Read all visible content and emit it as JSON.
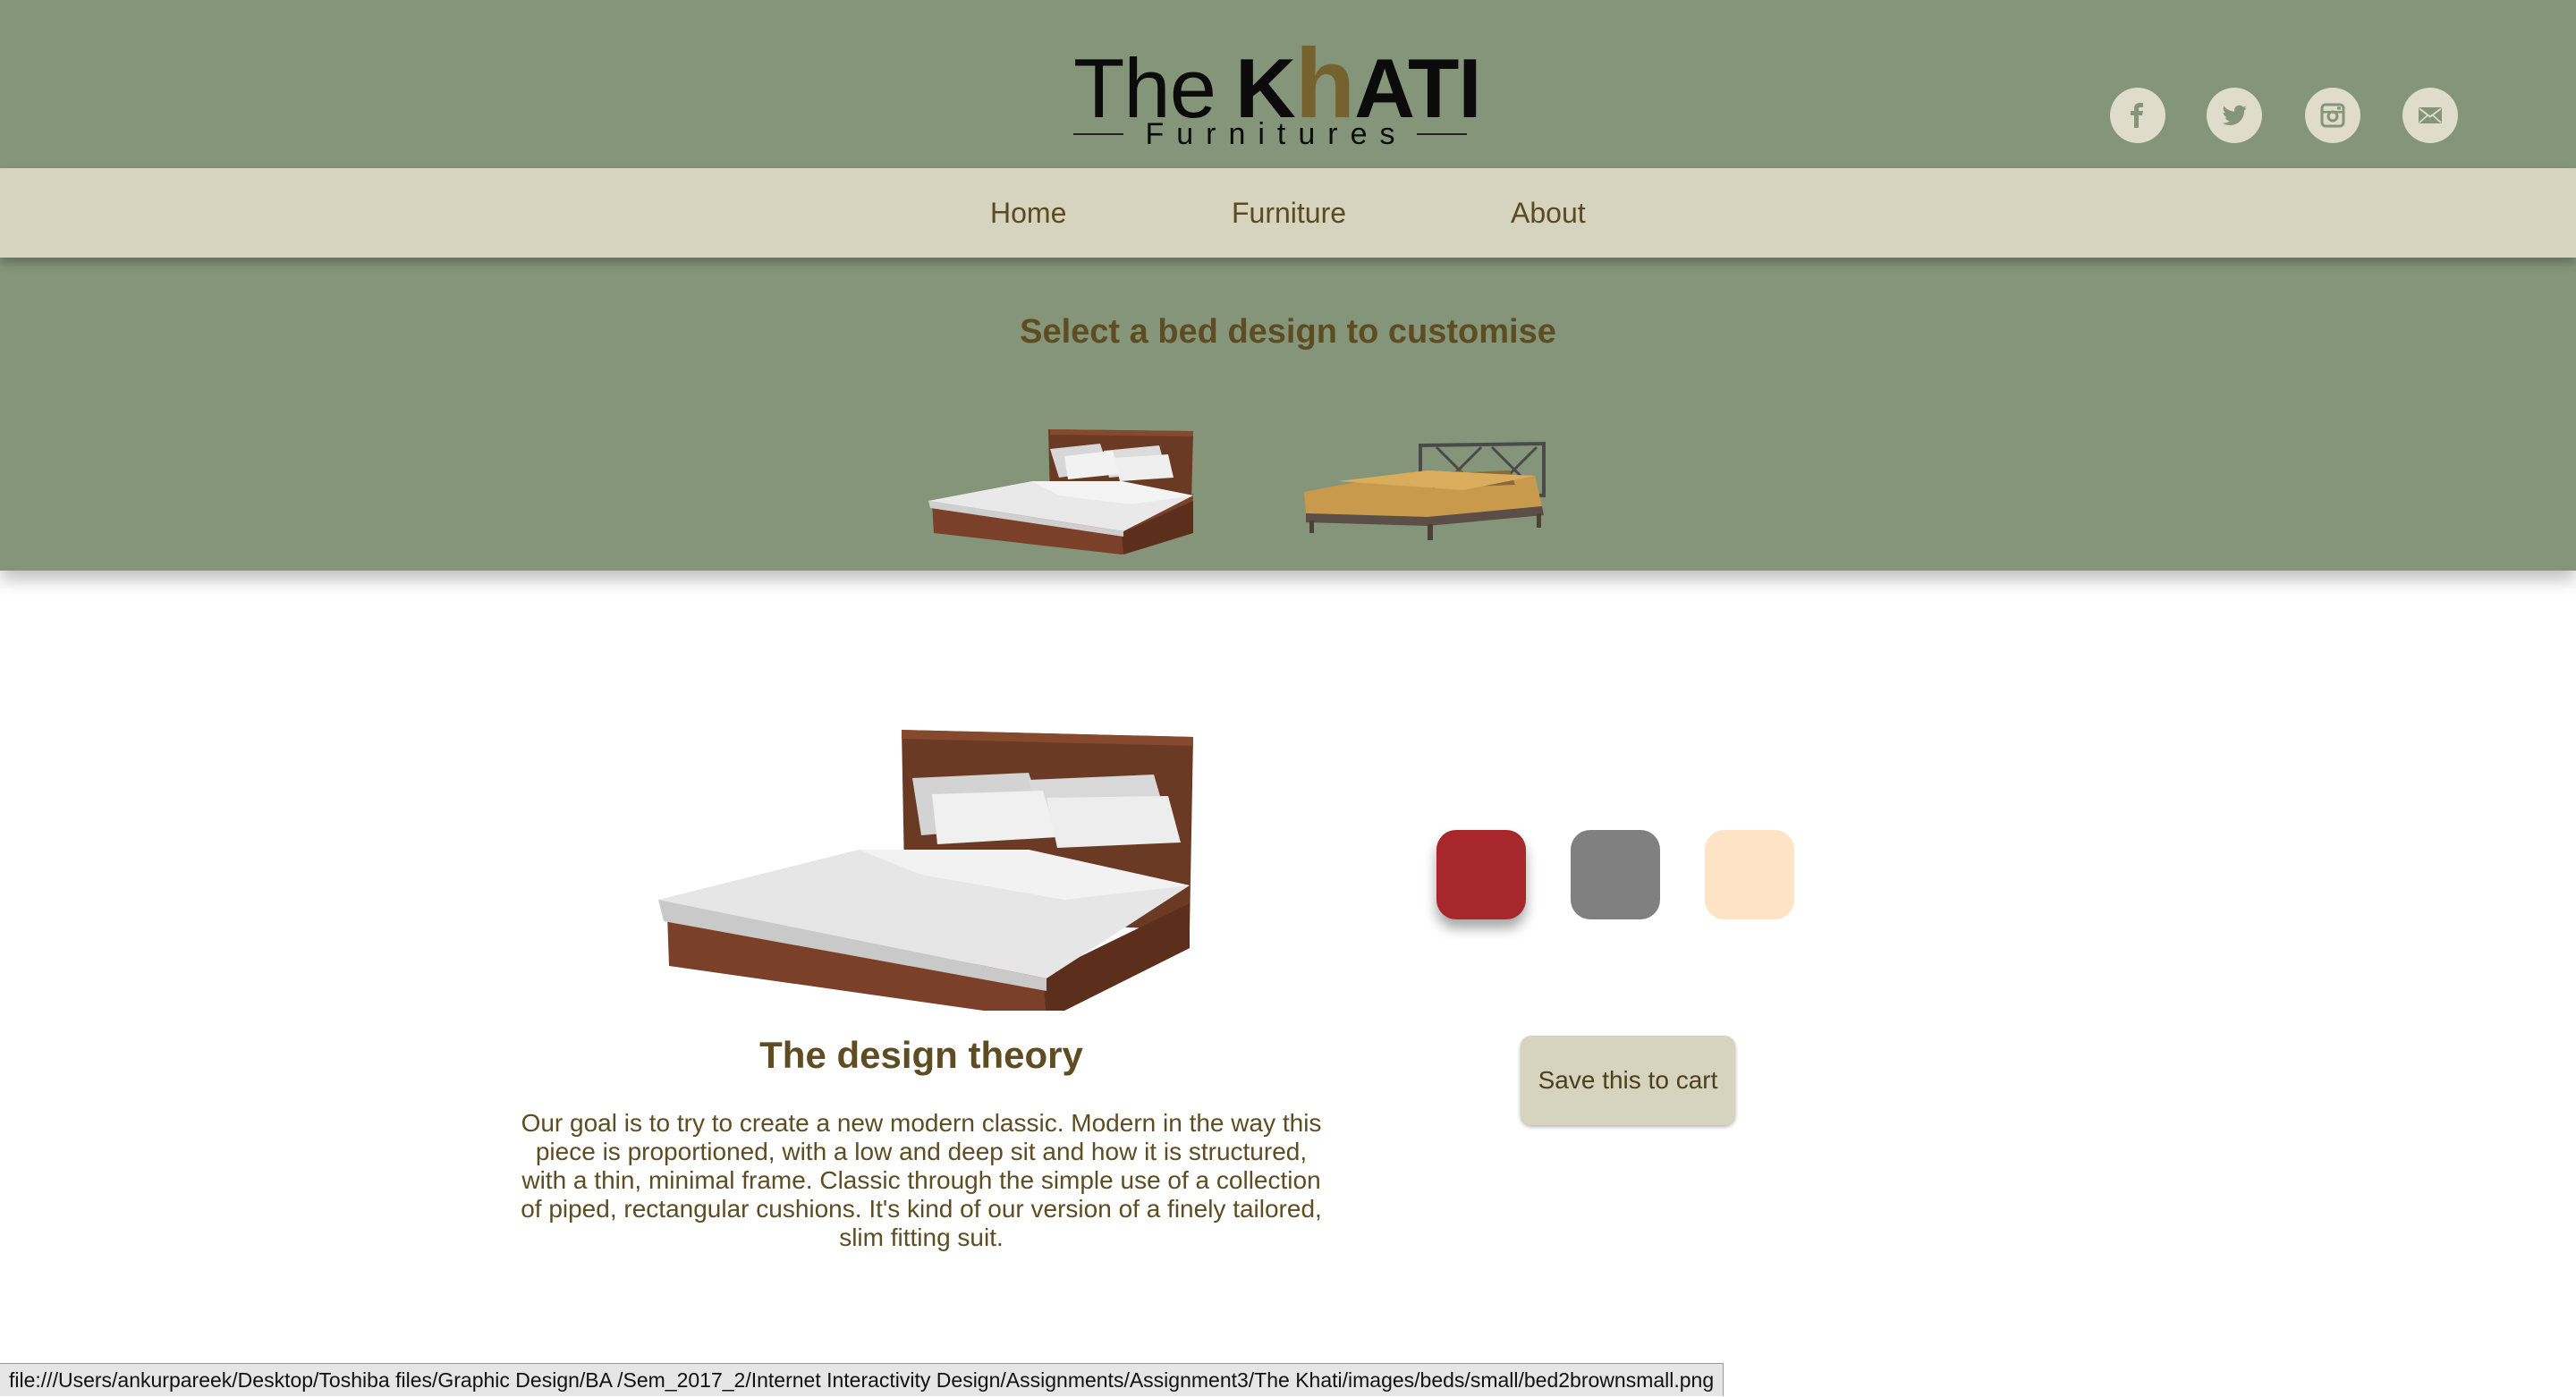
{
  "brand": {
    "logo_the": "The",
    "logo_k": "K",
    "logo_h": "h",
    "logo_ati": "ATI",
    "logo_sub": "Furnitures",
    "accent_color": "#76622e"
  },
  "social": [
    {
      "icon": "facebook-icon"
    },
    {
      "icon": "twitter-icon"
    },
    {
      "icon": "instagram-icon"
    },
    {
      "icon": "mail-icon"
    }
  ],
  "nav": {
    "home": "Home",
    "furniture": "Furniture",
    "about": "About"
  },
  "select": {
    "title": "Select a bed design to customise"
  },
  "design": {
    "title": "The design theory",
    "text": "Our goal is to try to create a new modern classic. Modern in the way this piece is proportioned, with a low and deep sit and how it is structured, with a thin, minimal frame. Classic through the simple use of a collection of piped, rectangular cushions. It's kind of our version of a finely tailored, slim fitting suit."
  },
  "swatches": [
    {
      "color": "#a8272c",
      "selected": true
    },
    {
      "color": "#808080",
      "selected": false
    },
    {
      "color": "#fee3c5",
      "selected": false
    }
  ],
  "cart": {
    "label": "Save this to cart"
  },
  "status_bar": {
    "url": "file:///Users/ankurpareek/Desktop/Toshiba files/Graphic Design/BA /Sem_2017_2/Internet Interactivity Design/Assignments/Assignment3/The Khati/images/beds/small/bed2brownsmall.png"
  },
  "colors": {
    "header_bg": "#84957a",
    "nav_bg": "#d6d3bf",
    "text_brown": "#5e4c22"
  }
}
